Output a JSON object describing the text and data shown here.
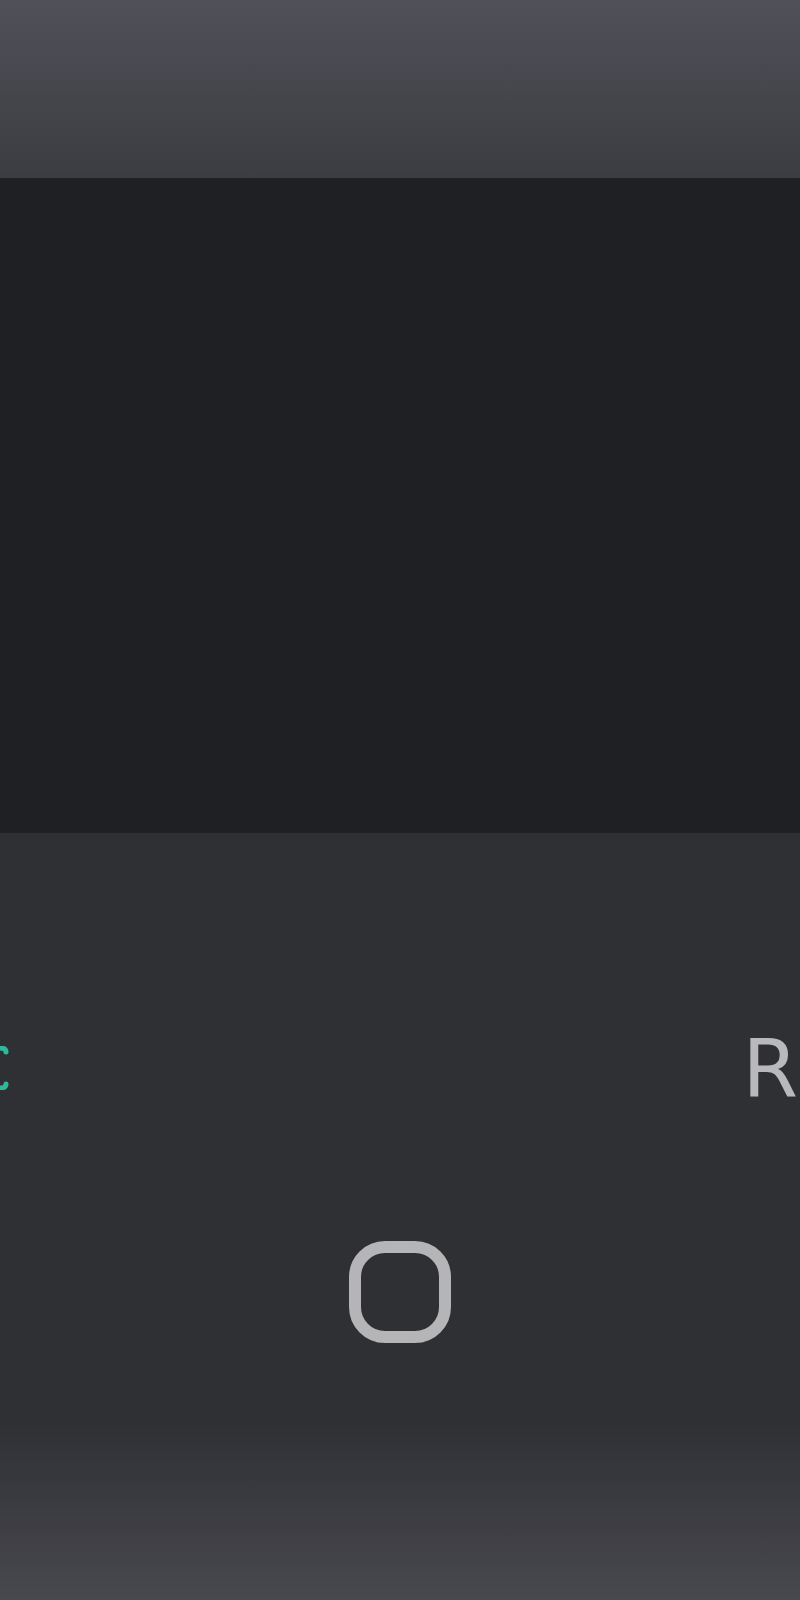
{
  "panel": {
    "right_label": "R"
  }
}
